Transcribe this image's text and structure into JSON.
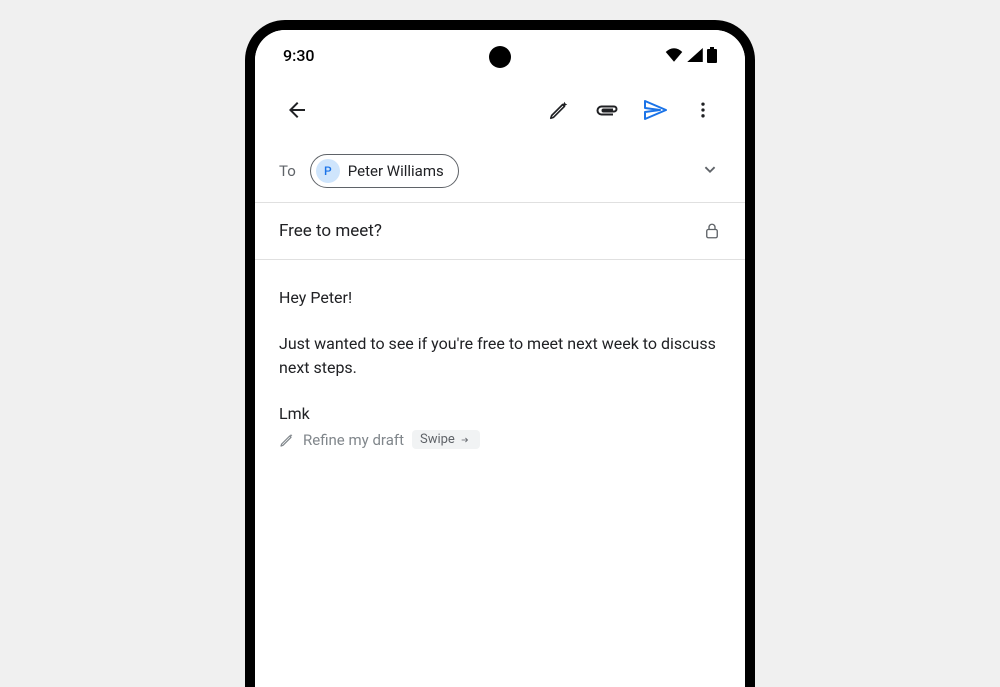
{
  "status": {
    "time": "9:30"
  },
  "compose": {
    "to_label": "To",
    "recipient": {
      "initial": "P",
      "name": "Peter Williams"
    },
    "subject": "Free to meet?",
    "body": {
      "greeting": "Hey Peter!",
      "paragraph": "Just wanted to see if you're free to meet next week to discuss next steps.",
      "signoff": "Lmk"
    },
    "refine": {
      "label": "Refine my draft",
      "hint": "Swipe"
    }
  }
}
